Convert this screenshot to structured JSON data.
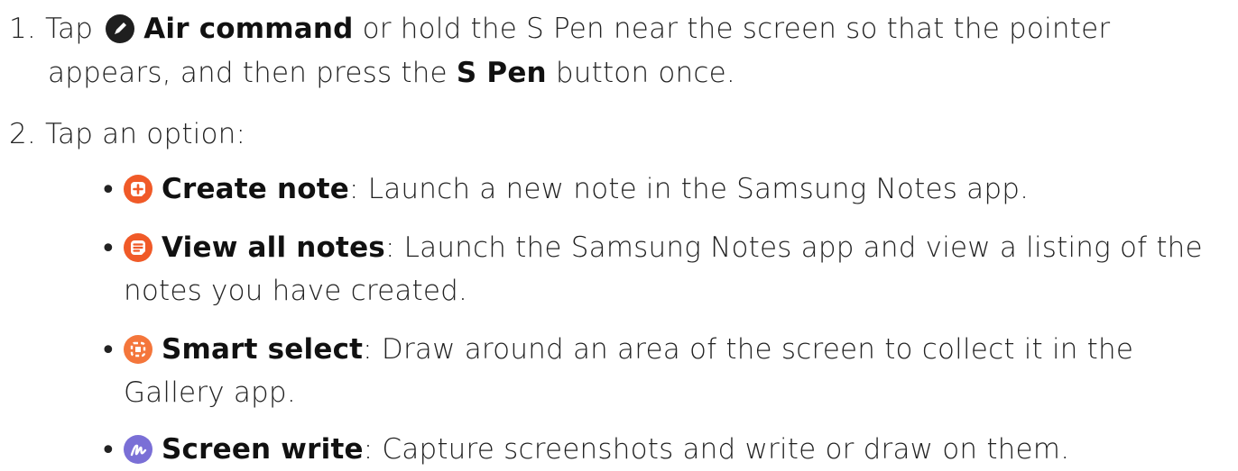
{
  "steps": [
    {
      "number": "1.",
      "line1": {
        "pre": "Tap",
        "icon": "air-command-pen-icon",
        "bold": "Air command",
        "post": " or hold the S Pen near the screen so that the pointer"
      },
      "line2": {
        "pre": "appears, and then press the ",
        "bold": "S Pen",
        "post": " button once."
      }
    },
    {
      "number": "2.",
      "text": "Tap an option:"
    }
  ],
  "options": [
    {
      "icon": "create-note-icon",
      "title": "Create note",
      "desc": ": Launch a new note in the Samsung Notes app.",
      "desc_cont": ""
    },
    {
      "icon": "view-all-notes-icon",
      "title": "View all notes",
      "desc": ": Launch the Samsung Notes app and view a listing of the",
      "desc_cont": "notes you have created."
    },
    {
      "icon": "smart-select-icon",
      "title": "Smart select",
      "desc": ": Draw around an area of the screen to collect it in the",
      "desc_cont": "Gallery app."
    },
    {
      "icon": "screen-write-icon",
      "title": "Screen write",
      "desc": ": Capture screenshots and write or draw on them.",
      "desc_cont": ""
    }
  ],
  "bullet_char": "•",
  "colors": {
    "text": "#222222",
    "air_command": "#1f1f1f",
    "notes_orange": "#f05a28",
    "smart_select_orange": "#f4763b",
    "screen_write_purple": "#7a6fd6"
  }
}
